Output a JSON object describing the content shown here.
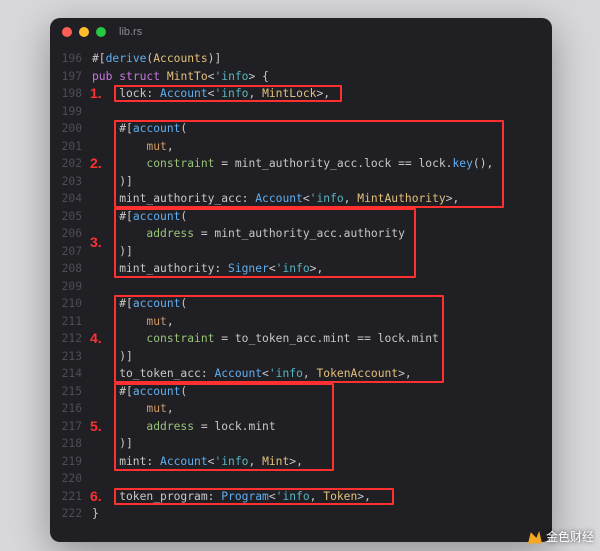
{
  "window": {
    "tab": "lib.rs"
  },
  "lines": {
    "start": 196,
    "end": 222
  },
  "code": [
    "#[derive(Accounts)]",
    "pub struct MintTo<'info> {",
    "    lock: Account<'info, MintLock>,",
    "",
    "    #[account(",
    "        mut,",
    "        constraint = mint_authority_acc.lock == lock.key(),",
    "    )]",
    "    mint_authority_acc: Account<'info, MintAuthority>,",
    "    #[account(",
    "        address = mint_authority_acc.authority",
    "    )]",
    "    mint_authority: Signer<'info>,",
    "",
    "    #[account(",
    "        mut,",
    "        constraint = to_token_acc.mint == lock.mint",
    "    )]",
    "    to_token_acc: Account<'info, TokenAccount>,",
    "    #[account(",
    "        mut,",
    "        address = lock.mint",
    "    )]",
    "    mint: Account<'info, Mint>,",
    "",
    "    token_program: Program<'info, Token>,",
    "}"
  ],
  "annotations": [
    "1.",
    "2.",
    "3.",
    "4.",
    "5.",
    "6."
  ],
  "watermark": "金色财经"
}
